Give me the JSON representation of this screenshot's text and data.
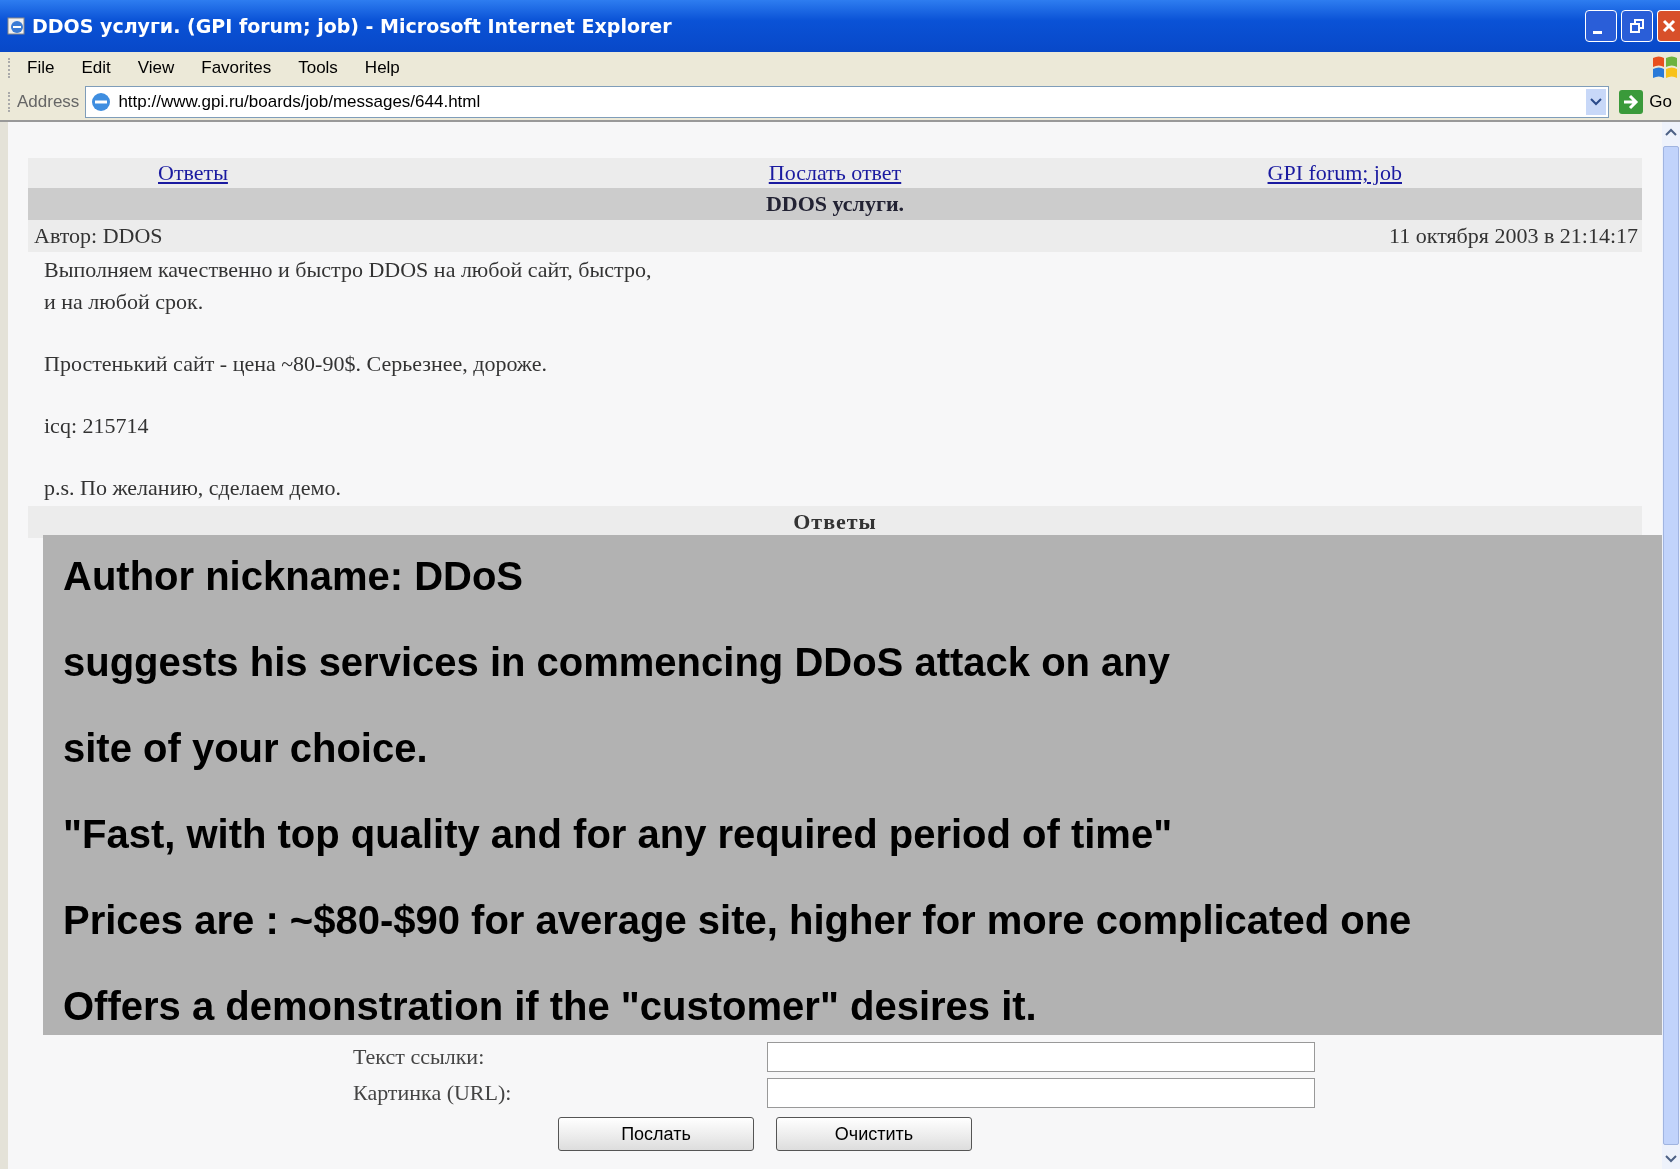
{
  "window": {
    "title": "DDOS услуги. (GPI forum; job) - Microsoft Internet Explorer"
  },
  "menu": [
    "File",
    "Edit",
    "View",
    "Favorites",
    "Tools",
    "Help"
  ],
  "address_bar": {
    "label": "Address",
    "url": "http://www.gpi.ru/boards/job/messages/644.html",
    "go": "Go"
  },
  "page": {
    "nav_links": [
      "Ответы",
      "Послать ответ",
      "GPI forum; job"
    ],
    "message": {
      "subject": "DDOS услуги.",
      "author": "Автор: DDOS",
      "date": "11 октября 2003 в 21:14:17",
      "paragraphs": [
        [
          "Выполняем качественно и быстро DDOS на любой сайт, быстро,",
          "и на любой срок."
        ],
        [
          "Простенький сайт - цена ~80-90$. Серьезнее, дороже."
        ],
        [
          "icq: 215714"
        ],
        [
          "p.s. По желанию, сделаем демо."
        ]
      ]
    },
    "replies_heading": "Ответы",
    "reply_form": {
      "fields": [
        {
          "kind": "input",
          "label": "Текст ссылки:"
        },
        {
          "kind": "input",
          "label": "Картинка (URL):"
        }
      ],
      "buttons": [
        "Послать",
        "Очистить"
      ]
    }
  },
  "annotation": {
    "lines": [
      "Author nickname: DDoS",
      "suggests his services in commencing DDoS attack on any",
      "site of your choice.",
      "\"Fast, with top quality and for any required period of time\"",
      "Prices are : ~$80-$90 for average site, higher for more complicated one",
      "Offers a demonstration if the \"customer\" desires it."
    ]
  }
}
